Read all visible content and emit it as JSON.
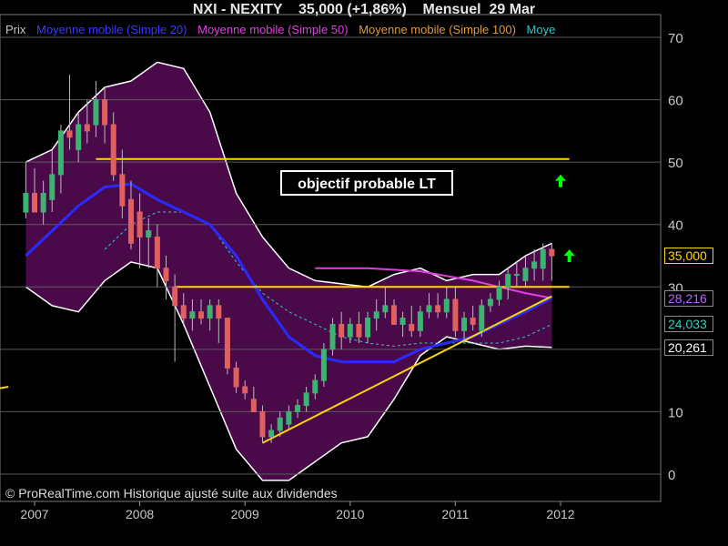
{
  "header": {
    "title": "NXI - NEXITY    35,000 (+1,86%)    Mensuel  29 Mar"
  },
  "legend": {
    "items": [
      {
        "label": "Prix",
        "color": "#c8c8c8"
      },
      {
        "label": "Moyenne mobile (Simple 20)",
        "color": "#3a3aff"
      },
      {
        "label": "Moyenne mobile (Simple 50)",
        "color": "#e040e0"
      },
      {
        "label": "Moyenne mobile (Simple 100)",
        "color": "#e09a40"
      },
      {
        "label": "Moye",
        "color": "#30c8c8"
      }
    ]
  },
  "annotation": {
    "text": "objectif probable LT"
  },
  "credit": {
    "text": "© ProRealTime.com Historique ajusté suite aux dividendes"
  },
  "price_boxes": [
    {
      "value": "35,000",
      "color": "#ffd700",
      "price": 35.0
    },
    {
      "value": "28,216",
      "color": "#c060ff",
      "price": 28.216
    },
    {
      "value": "24,033",
      "color": "#30d0c0",
      "price": 24.033
    },
    {
      "value": "20,261",
      "color": "#ffffff",
      "price": 20.261
    }
  ],
  "colors": {
    "background": "#000000",
    "band_fill": "#4a0a4a",
    "band_edge": "#ffffff",
    "up_candle": "#3cb371",
    "down_candle": "#e06060",
    "ma20": "#2a2aff",
    "ma50": "#e040e0",
    "ma_dashed": "#30c8c8",
    "trend": "#ffd700",
    "arrow": "#00ff00",
    "grid": "#5a5a5a",
    "axis_text": "#c8c8c8"
  },
  "chart_data": {
    "type": "candlestick",
    "x_label_years": [
      "2007",
      "2008",
      "2009",
      "2010",
      "2011",
      "2012"
    ],
    "y_ticks": [
      0,
      10,
      20,
      30,
      40,
      50,
      60,
      70
    ],
    "ylim": [
      -3,
      71
    ],
    "grid": true,
    "last_close": 35.0,
    "change_pct": "+1,86%",
    "candles": [
      {
        "date": "2006-12",
        "o": 42,
        "h": 50,
        "l": 41,
        "c": 45
      },
      {
        "date": "2007-01",
        "o": 45,
        "h": 49,
        "l": 43,
        "c": 42
      },
      {
        "date": "2007-02",
        "o": 42,
        "h": 47,
        "l": 40,
        "c": 45
      },
      {
        "date": "2007-03",
        "o": 44,
        "h": 52,
        "l": 42,
        "c": 48
      },
      {
        "date": "2007-04",
        "o": 48,
        "h": 56,
        "l": 45,
        "c": 55
      },
      {
        "date": "2007-05",
        "o": 55,
        "h": 64,
        "l": 52,
        "c": 54
      },
      {
        "date": "2007-06",
        "o": 52,
        "h": 58,
        "l": 50,
        "c": 56
      },
      {
        "date": "2007-07",
        "o": 56,
        "h": 60,
        "l": 53,
        "c": 55
      },
      {
        "date": "2007-08",
        "o": 56,
        "h": 63,
        "l": 54,
        "c": 60
      },
      {
        "date": "2007-09",
        "o": 60,
        "h": 62,
        "l": 53,
        "c": 56
      },
      {
        "date": "2007-10",
        "o": 56,
        "h": 58,
        "l": 47,
        "c": 48
      },
      {
        "date": "2007-11",
        "o": 48,
        "h": 52,
        "l": 41,
        "c": 43
      },
      {
        "date": "2007-12",
        "o": 44,
        "h": 47,
        "l": 36,
        "c": 37
      },
      {
        "date": "2008-01",
        "o": 42,
        "h": 45,
        "l": 33,
        "c": 38
      },
      {
        "date": "2008-02",
        "o": 38,
        "h": 41,
        "l": 33,
        "c": 39
      },
      {
        "date": "2008-03",
        "o": 38,
        "h": 40,
        "l": 30,
        "c": 33
      },
      {
        "date": "2008-04",
        "o": 33,
        "h": 35,
        "l": 28,
        "c": 31
      },
      {
        "date": "2008-05",
        "o": 30,
        "h": 32,
        "l": 18,
        "c": 27
      },
      {
        "date": "2008-06",
        "o": 27,
        "h": 29,
        "l": 24,
        "c": 25
      },
      {
        "date": "2008-07",
        "o": 25,
        "h": 28,
        "l": 23,
        "c": 26
      },
      {
        "date": "2008-08",
        "o": 26,
        "h": 28,
        "l": 24,
        "c": 25
      },
      {
        "date": "2008-09",
        "o": 25,
        "h": 28,
        "l": 23,
        "c": 27
      },
      {
        "date": "2008-10",
        "o": 27,
        "h": 28,
        "l": 21,
        "c": 25
      },
      {
        "date": "2008-11",
        "o": 25,
        "h": 25,
        "l": 16,
        "c": 17
      },
      {
        "date": "2008-12",
        "o": 17,
        "h": 18,
        "l": 13,
        "c": 14
      },
      {
        "date": "2009-01",
        "o": 14,
        "h": 15,
        "l": 12,
        "c": 13
      },
      {
        "date": "2009-02",
        "o": 12,
        "h": 14,
        "l": 10,
        "c": 10
      },
      {
        "date": "2009-03",
        "o": 10,
        "h": 11,
        "l": 5,
        "c": 6
      },
      {
        "date": "2009-04",
        "o": 6,
        "h": 8,
        "l": 5,
        "c": 7
      },
      {
        "date": "2009-05",
        "o": 7,
        "h": 10,
        "l": 6,
        "c": 9
      },
      {
        "date": "2009-06",
        "o": 8,
        "h": 11,
        "l": 7,
        "c": 10
      },
      {
        "date": "2009-07",
        "o": 10,
        "h": 12,
        "l": 9,
        "c": 11
      },
      {
        "date": "2009-08",
        "o": 11,
        "h": 14,
        "l": 10,
        "c": 13
      },
      {
        "date": "2009-09",
        "o": 13,
        "h": 16,
        "l": 12,
        "c": 15
      },
      {
        "date": "2009-10",
        "o": 15,
        "h": 21,
        "l": 14,
        "c": 20
      },
      {
        "date": "2009-11",
        "o": 20,
        "h": 25,
        "l": 19,
        "c": 24
      },
      {
        "date": "2009-12",
        "o": 24,
        "h": 26,
        "l": 20,
        "c": 22
      },
      {
        "date": "2010-01",
        "o": 22,
        "h": 25,
        "l": 21,
        "c": 24
      },
      {
        "date": "2010-02",
        "o": 24,
        "h": 26,
        "l": 21,
        "c": 22
      },
      {
        "date": "2010-03",
        "o": 22,
        "h": 26,
        "l": 21,
        "c": 25
      },
      {
        "date": "2010-04",
        "o": 25,
        "h": 28,
        "l": 23,
        "c": 26
      },
      {
        "date": "2010-05",
        "o": 26,
        "h": 30,
        "l": 25,
        "c": 27
      },
      {
        "date": "2010-06",
        "o": 27,
        "h": 28,
        "l": 24,
        "c": 24
      },
      {
        "date": "2010-07",
        "o": 24,
        "h": 26,
        "l": 22,
        "c": 25
      },
      {
        "date": "2010-08",
        "o": 24,
        "h": 27,
        "l": 22,
        "c": 23
      },
      {
        "date": "2010-09",
        "o": 23,
        "h": 27,
        "l": 22,
        "c": 26
      },
      {
        "date": "2010-10",
        "o": 26,
        "h": 29,
        "l": 25,
        "c": 27
      },
      {
        "date": "2010-11",
        "o": 27,
        "h": 29,
        "l": 25,
        "c": 26
      },
      {
        "date": "2010-12",
        "o": 26,
        "h": 30,
        "l": 25,
        "c": 28
      },
      {
        "date": "2011-01",
        "o": 28,
        "h": 30,
        "l": 22,
        "c": 23
      },
      {
        "date": "2011-02",
        "o": 23,
        "h": 26,
        "l": 21,
        "c": 25
      },
      {
        "date": "2011-03",
        "o": 25,
        "h": 27,
        "l": 23,
        "c": 24
      },
      {
        "date": "2011-04",
        "o": 23,
        "h": 28,
        "l": 22,
        "c": 27
      },
      {
        "date": "2011-05",
        "o": 27,
        "h": 29,
        "l": 26,
        "c": 28
      },
      {
        "date": "2011-06",
        "o": 28,
        "h": 31,
        "l": 27,
        "c": 30
      },
      {
        "date": "2011-07",
        "o": 30,
        "h": 33,
        "l": 28,
        "c": 32
      },
      {
        "date": "2011-08",
        "o": 32,
        "h": 34,
        "l": 30,
        "c": 32
      },
      {
        "date": "2011-09",
        "o": 31,
        "h": 35,
        "l": 30,
        "c": 33
      },
      {
        "date": "2011-10",
        "o": 33,
        "h": 36,
        "l": 31,
        "c": 34
      },
      {
        "date": "2011-11",
        "o": 33,
        "h": 37,
        "l": 31,
        "c": 36
      },
      {
        "date": "2011-12",
        "o": 36,
        "h": 37,
        "l": 31,
        "c": 35
      }
    ],
    "bollinger_upper": [
      [
        "2006-12",
        50
      ],
      [
        "2007-03",
        52
      ],
      [
        "2007-06",
        58
      ],
      [
        "2007-09",
        62
      ],
      [
        "2007-12",
        63
      ],
      [
        "2008-03",
        66
      ],
      [
        "2008-06",
        65
      ],
      [
        "2008-09",
        58
      ],
      [
        "2008-12",
        45
      ],
      [
        "2009-03",
        38
      ],
      [
        "2009-06",
        33
      ],
      [
        "2009-09",
        31
      ],
      [
        "2009-12",
        30.5
      ],
      [
        "2010-03",
        30
      ],
      [
        "2010-06",
        32
      ],
      [
        "2010-09",
        33
      ],
      [
        "2010-12",
        31
      ],
      [
        "2011-03",
        32
      ],
      [
        "2011-06",
        32
      ],
      [
        "2011-09",
        35
      ],
      [
        "2011-12",
        37
      ]
    ],
    "bollinger_lower": [
      [
        "2006-12",
        30
      ],
      [
        "2007-03",
        27
      ],
      [
        "2007-06",
        26
      ],
      [
        "2007-09",
        31
      ],
      [
        "2007-12",
        34
      ],
      [
        "2008-03",
        33
      ],
      [
        "2008-06",
        24
      ],
      [
        "2008-09",
        14
      ],
      [
        "2008-12",
        4
      ],
      [
        "2009-03",
        -1
      ],
      [
        "2009-06",
        -1
      ],
      [
        "2009-09",
        2
      ],
      [
        "2009-12",
        5
      ],
      [
        "2010-03",
        6
      ],
      [
        "2010-06",
        12
      ],
      [
        "2010-09",
        19
      ],
      [
        "2010-12",
        22
      ],
      [
        "2011-03",
        21
      ],
      [
        "2011-06",
        20
      ],
      [
        "2011-09",
        20.5
      ],
      [
        "2011-12",
        20.3
      ]
    ],
    "sma20": [
      [
        "2006-12",
        35
      ],
      [
        "2007-03",
        39
      ],
      [
        "2007-06",
        43
      ],
      [
        "2007-09",
        46
      ],
      [
        "2007-12",
        46.5
      ],
      [
        "2008-03",
        44
      ],
      [
        "2008-06",
        42
      ],
      [
        "2008-09",
        40
      ],
      [
        "2008-12",
        35
      ],
      [
        "2009-03",
        28
      ],
      [
        "2009-06",
        22
      ],
      [
        "2009-09",
        19
      ],
      [
        "2009-12",
        18
      ],
      [
        "2010-03",
        18
      ],
      [
        "2010-06",
        18
      ],
      [
        "2010-09",
        20
      ],
      [
        "2010-12",
        21
      ],
      [
        "2011-03",
        22
      ],
      [
        "2011-06",
        24
      ],
      [
        "2011-09",
        26
      ],
      [
        "2011-12",
        28.2
      ]
    ],
    "sma50": [
      [
        "2009-09",
        33
      ],
      [
        "2010-03",
        33
      ],
      [
        "2010-09",
        32.5
      ],
      [
        "2011-03",
        31
      ],
      [
        "2011-06",
        30
      ],
      [
        "2011-09",
        29
      ],
      [
        "2011-12",
        28.2
      ]
    ],
    "dashed_ma": [
      [
        "2007-09",
        36
      ],
      [
        "2007-12",
        40
      ],
      [
        "2008-03",
        42
      ],
      [
        "2008-06",
        42
      ],
      [
        "2008-09",
        40
      ],
      [
        "2008-12",
        34
      ],
      [
        "2009-03",
        29
      ],
      [
        "2009-06",
        26
      ],
      [
        "2009-09",
        24
      ],
      [
        "2009-12",
        22
      ],
      [
        "2010-03",
        21
      ],
      [
        "2010-06",
        20.5
      ],
      [
        "2010-09",
        21
      ],
      [
        "2010-12",
        21
      ],
      [
        "2011-03",
        21
      ],
      [
        "2011-06",
        21
      ],
      [
        "2011-09",
        22
      ],
      [
        "2011-12",
        24
      ]
    ],
    "horizontal_lines": [
      {
        "date_from": "2007-08",
        "date_to": "2012-02",
        "value": 50.5
      },
      {
        "date_from": "2008-05",
        "date_to": "2012-02",
        "value": 30
      }
    ],
    "trendline": {
      "date_from": "2009-03",
      "value_from": 5,
      "date_to": "2011-12",
      "value_to": 28.5
    },
    "small_segment": {
      "date_from": "2006-06",
      "value_from": 13,
      "date_to": "2006-10",
      "value_to": 14
    },
    "arrows": [
      {
        "date": "2012-01",
        "value": 47
      },
      {
        "date": "2012-02",
        "value": 35
      }
    ]
  }
}
